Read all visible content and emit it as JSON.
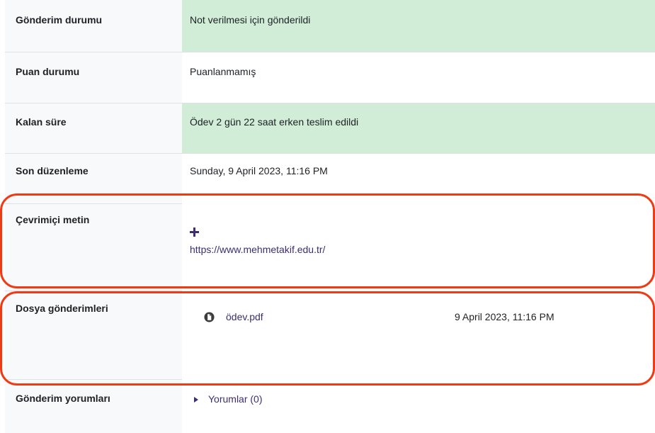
{
  "rows": {
    "submission_status": {
      "label": "Gönderim durumu",
      "value": "Not verilmesi için gönderildi"
    },
    "grading_status": {
      "label": "Puan durumu",
      "value": "Puanlanmamış"
    },
    "time_remaining": {
      "label": "Kalan süre",
      "value": "Ödev 2 gün 22 saat erken teslim edildi"
    },
    "last_modified": {
      "label": "Son düzenleme",
      "value": "Sunday, 9 April 2023, 11:16 PM"
    },
    "online_text": {
      "label": "Çevrimiçi metin",
      "link": "https://www.mehmetakif.edu.tr/"
    },
    "file_submissions": {
      "label": "Dosya gönderimleri",
      "file_name": "ödev.pdf",
      "file_date": "9 April 2023, 11:16 PM"
    },
    "submission_comments": {
      "label": "Gönderim yorumları",
      "comments_link": "Yorumlar (0)"
    }
  },
  "colors": {
    "highlight": "#f03a14",
    "success_bg": "#d1ecd7",
    "link": "#3d2e70"
  },
  "icons": [
    "plus-icon",
    "file-icon",
    "caret-right-icon"
  ]
}
